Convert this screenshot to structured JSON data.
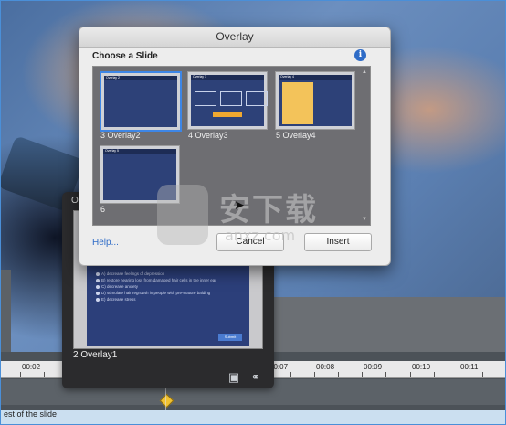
{
  "dialog": {
    "title": "Overlay",
    "choose_label": "Choose a Slide",
    "info_icon": "i",
    "help_link": "Help...",
    "cancel_button": "Cancel",
    "insert_button": "Insert",
    "slides": [
      {
        "caption": "3  Overlay2",
        "tag": "Overlay 2",
        "selected": true
      },
      {
        "caption": "4  Overlay3",
        "tag": "Overlay 3",
        "selected": false
      },
      {
        "caption": "5  Overlay4",
        "tag": "Overlay 4",
        "selected": false
      },
      {
        "caption": "6",
        "tag": "Overlay 5",
        "selected": false
      }
    ]
  },
  "popover": {
    "letter": "O",
    "slide_label": "2  Overlay1",
    "submit_label": "Submit",
    "options": [
      "A) decrease feelings of depression",
      "B) restore hearing loss from damaged hair cells in the inner ear",
      "C) decrease anxiety",
      "D) stimulate hair regrowth in people with pre-mature balding",
      "E) decrease stress"
    ]
  },
  "timeline": {
    "ticks": [
      "00:02",
      "00:07",
      "00:08",
      "00:09",
      "00:10",
      "00:11"
    ],
    "slide_track_label": "est of the slide"
  },
  "watermark": {
    "text": "安下载",
    "url": "anxz.com"
  },
  "colors": {
    "accent": "#2f6cc7",
    "marker": "#f1c232",
    "selection": "#3d86e6"
  }
}
